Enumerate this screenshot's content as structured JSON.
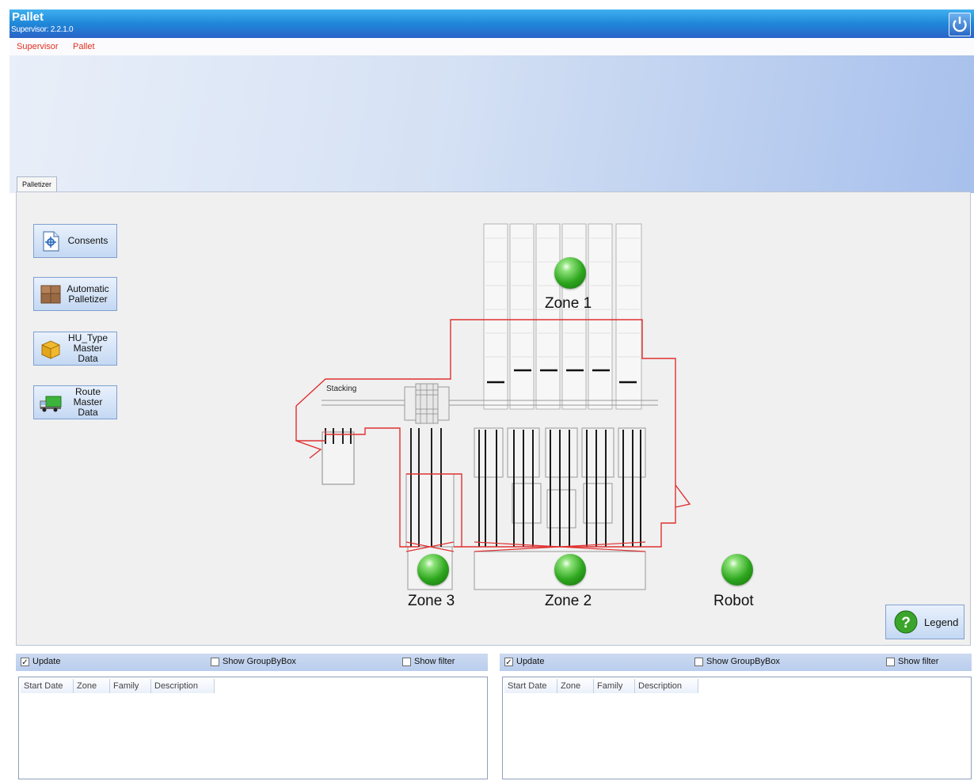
{
  "app": {
    "title": "Pallet",
    "subtitle": "Supervisor: 2.2.1.0"
  },
  "menu": [
    "Supervisor",
    "Pallet"
  ],
  "tabs": [
    "Palletizer"
  ],
  "sidebar": [
    {
      "label": "Consents",
      "icon": "document-icon"
    },
    {
      "label": "Automatic\nPalletizer",
      "icon": "boxes-icon"
    },
    {
      "label": "HU_Type\nMaster\nData",
      "icon": "package-icon"
    },
    {
      "label": "Route\nMaster\nData",
      "icon": "truck-icon"
    }
  ],
  "layout": {
    "stacking_label": "Stacking",
    "zones": [
      {
        "label": "Zone 1",
        "status": "green"
      },
      {
        "label": "Zone 2",
        "status": "green"
      },
      {
        "label": "Zone 3",
        "status": "green"
      },
      {
        "label": "Robot",
        "status": "green"
      }
    ]
  },
  "legend_button": "Legend",
  "log_panels": [
    {
      "update_label": "Update",
      "update_checked": true,
      "groupbybox_label": "Show GroupByBox",
      "filter_label": "Show filter",
      "columns": [
        "Start Date",
        "Zone",
        "Family",
        "Description"
      ]
    },
    {
      "update_label": "Update",
      "update_checked": true,
      "groupbybox_label": "Show GroupByBox",
      "filter_label": "Show filter",
      "columns": [
        "Start Date",
        "Zone",
        "Family",
        "Description"
      ]
    }
  ],
  "colors": {
    "status_ok": "#2ea61e",
    "route_line": "#e03030",
    "accent": "#1f87d8"
  }
}
